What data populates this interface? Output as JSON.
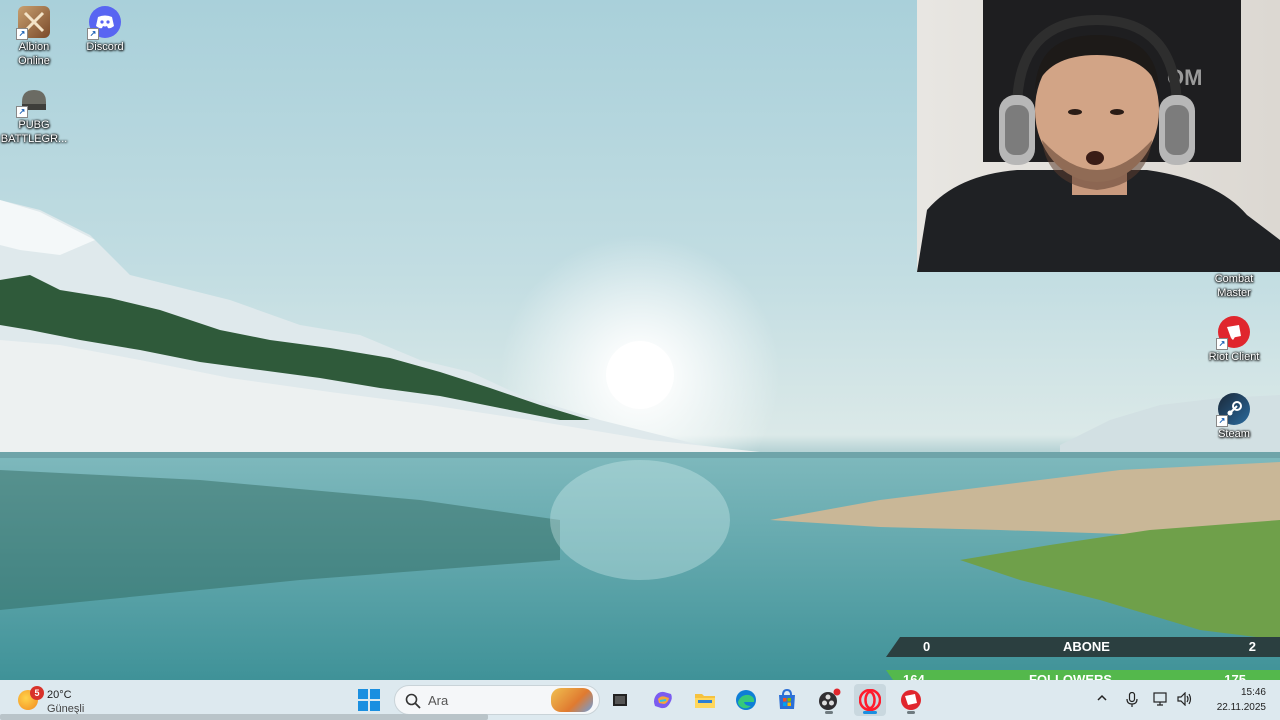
{
  "desktop": {
    "icons": [
      {
        "label": "Albion\nOnline",
        "icon": "albion-online-icon"
      },
      {
        "label": "Discord",
        "icon": "discord-icon"
      },
      {
        "label": "PUBG\nBATTLEGR...",
        "icon": "pubg-icon"
      },
      {
        "label": "Combat\nMaster",
        "icon": "combat-master-icon"
      },
      {
        "label": "Riot Client",
        "icon": "riot-client-icon"
      },
      {
        "label": "Steam",
        "icon": "steam-icon"
      }
    ]
  },
  "webcam": {
    "banner_text": "OM"
  },
  "overlay": {
    "abone": {
      "left": "0",
      "label": "ABONE",
      "right": "2",
      "bg": "#2b3f40"
    },
    "followers": {
      "left": "164",
      "label": "FOLLOWERS",
      "right": "175",
      "bg": "#54b84c"
    }
  },
  "taskbar": {
    "weather": {
      "badge": "5",
      "temp": "20°C",
      "condition": "Güneşli"
    },
    "search_placeholder": "Ara",
    "apps": [
      "windows-start-icon",
      "search-icon",
      "task-view-icon",
      "copilot-icon",
      "file-explorer-icon",
      "edge-icon",
      "microsoft-store-icon",
      "obs-icon",
      "opera-icon",
      "riot-client-icon"
    ],
    "tray": [
      "chevron-up-icon",
      "microphone-icon",
      "network-icon",
      "speaker-icon"
    ],
    "clock": {
      "time": "15:46",
      "date": "22.11.2025"
    }
  },
  "colors": {
    "taskbar_bg": "#dde9ef",
    "overlay_dark": "#2b3f40",
    "overlay_green": "#54b84c"
  }
}
